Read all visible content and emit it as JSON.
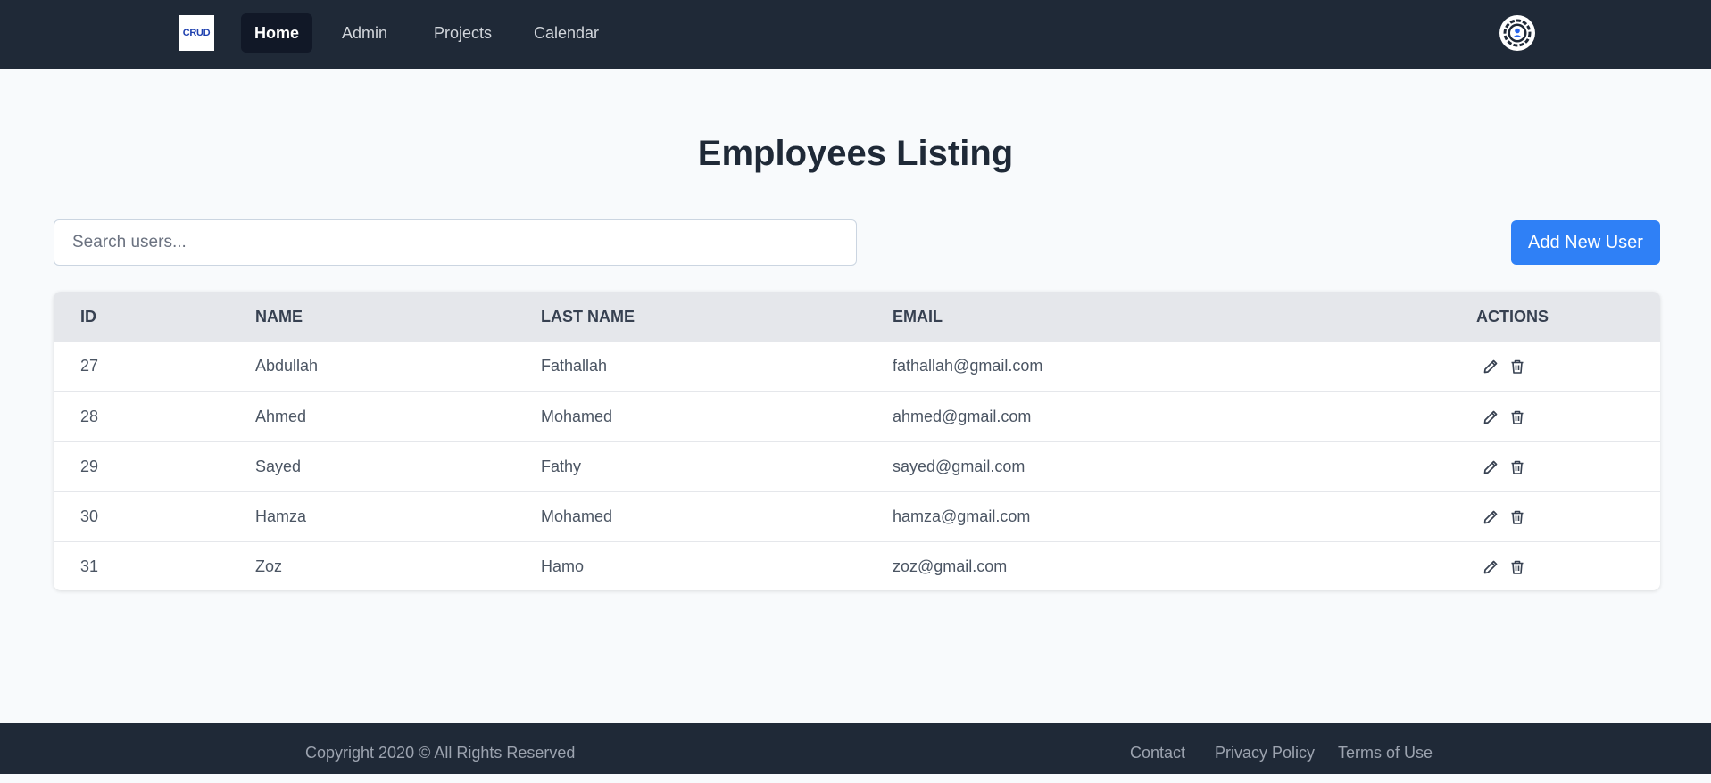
{
  "nav": {
    "logo_text": "CRUD",
    "links": [
      {
        "label": "Home",
        "active": true
      },
      {
        "label": "Admin",
        "active": false
      },
      {
        "label": "Projects",
        "active": false
      },
      {
        "label": "Calendar",
        "active": false
      }
    ],
    "user_icon": "user-circle-icon"
  },
  "main": {
    "title": "Employees Listing",
    "search": {
      "placeholder": "Search users...",
      "value": ""
    },
    "add_button_label": "Add New User",
    "table": {
      "headers": [
        "ID",
        "NAME",
        "LAST NAME",
        "EMAIL",
        "ACTIONS"
      ],
      "rows": [
        {
          "id": "27",
          "name": "Abdullah",
          "last_name": "Fathallah",
          "email": "fathallah@gmail.com"
        },
        {
          "id": "28",
          "name": "Ahmed",
          "last_name": "Mohamed",
          "email": "ahmed@gmail.com"
        },
        {
          "id": "29",
          "name": "Sayed",
          "last_name": "Fathy",
          "email": "sayed@gmail.com"
        },
        {
          "id": "30",
          "name": "Hamza",
          "last_name": "Mohamed",
          "email": "hamza@gmail.com"
        },
        {
          "id": "31",
          "name": "Zoz",
          "last_name": "Hamo",
          "email": "zoz@gmail.com"
        }
      ],
      "action_icons": [
        "pencil-icon",
        "trash-icon"
      ]
    }
  },
  "footer": {
    "copyright": "Copyright 2020 © All Rights Reserved",
    "links": [
      "Contact",
      "Privacy Policy",
      "Terms of Use"
    ]
  },
  "colors": {
    "navbar_bg": "#1f2937",
    "primary_button": "#2f80f6",
    "page_bg": "#f8fafc",
    "table_header_bg": "#e5e7eb"
  }
}
